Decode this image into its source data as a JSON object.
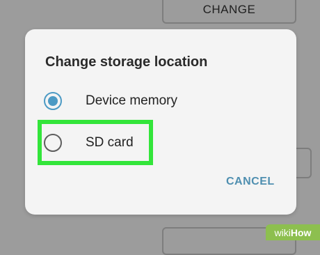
{
  "background": {
    "change_button_label": "CHANGE"
  },
  "dialog": {
    "title": "Change storage location",
    "options": [
      {
        "label": "Device memory",
        "selected": true
      },
      {
        "label": "SD card",
        "selected": false
      }
    ],
    "cancel_label": "CANCEL"
  },
  "colors": {
    "accent": "#4c9ac4",
    "highlight": "#33e53a",
    "overlay": "#9c9c9c",
    "watermark": "#8dbf4f"
  },
  "watermark": {
    "text_wiki": "wiki",
    "text_how": "How"
  }
}
